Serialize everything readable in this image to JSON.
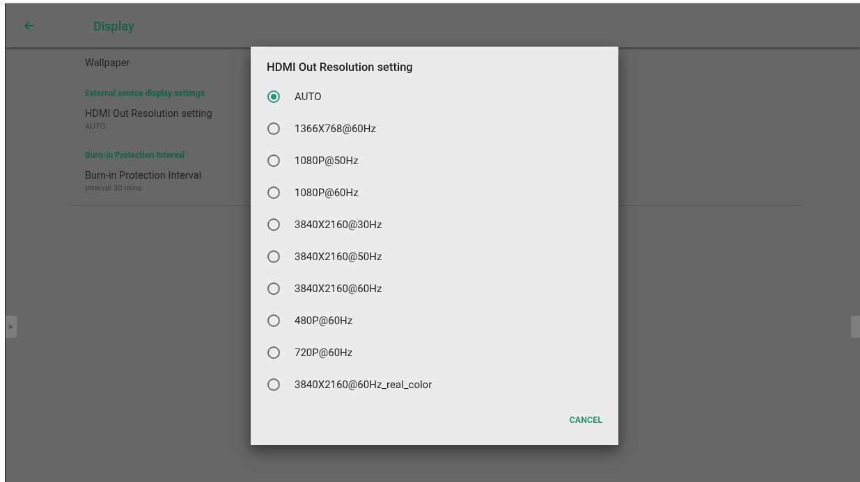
{
  "header": {
    "title": "Display"
  },
  "settings": [
    {
      "kind": "item",
      "title": "Wallpaper"
    },
    {
      "kind": "category",
      "title": "External source display settings"
    },
    {
      "kind": "item",
      "title": "HDMI Out Resolution setting",
      "summary": "AUTO"
    },
    {
      "kind": "category",
      "title": "Burn-in Protection Interval"
    },
    {
      "kind": "item",
      "title": "Burn-in Protection Interval",
      "summary": "Interval 30 mins"
    }
  ],
  "dialog": {
    "title": "HDMI Out Resolution setting",
    "options": [
      {
        "label": "AUTO",
        "selected": true
      },
      {
        "label": "1366X768@60Hz",
        "selected": false
      },
      {
        "label": "1080P@50Hz",
        "selected": false
      },
      {
        "label": "1080P@60Hz",
        "selected": false
      },
      {
        "label": "3840X2160@30Hz",
        "selected": false
      },
      {
        "label": "3840X2160@50Hz",
        "selected": false
      },
      {
        "label": "3840X2160@60Hz",
        "selected": false
      },
      {
        "label": "480P@60Hz",
        "selected": false
      },
      {
        "label": "720P@60Hz",
        "selected": false
      },
      {
        "label": "3840X2160@60Hz_real_color",
        "selected": false
      }
    ],
    "buttons": [
      "CANCEL"
    ]
  }
}
